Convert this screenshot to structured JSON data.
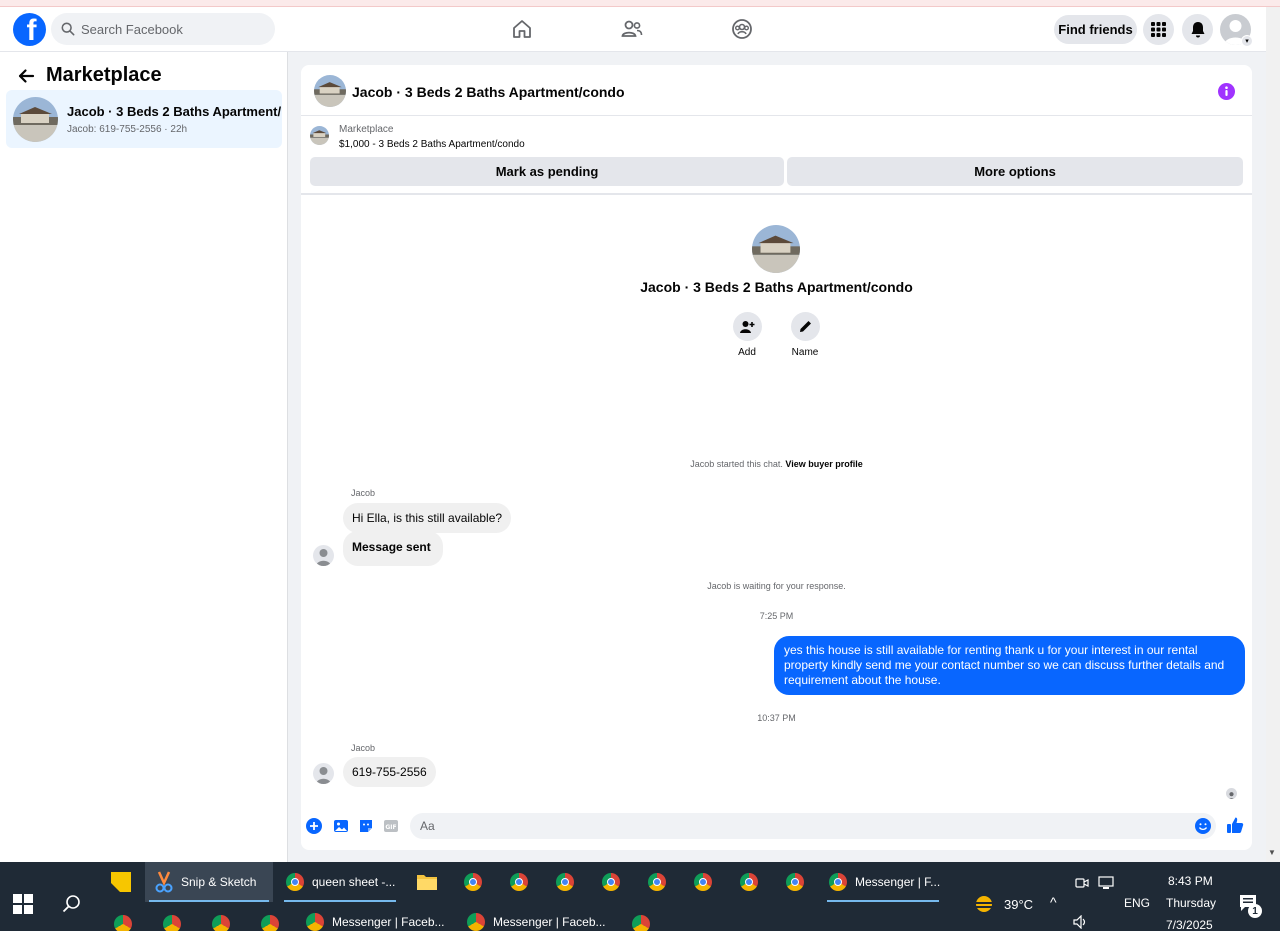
{
  "header": {
    "search_placeholder": "Search Facebook",
    "find_friends": "Find friends",
    "logo_letter": "f"
  },
  "sidebar": {
    "title": "Marketplace",
    "items": [
      {
        "title": "Jacob · 3 Beds 2 Baths Apartment/...",
        "subtitle": "Jacob: 619-755-2556 · 22h"
      }
    ]
  },
  "chat": {
    "title": "Jacob · 3 Beds 2 Baths Apartment/condo",
    "listing_category": "Marketplace",
    "listing_price": "$1,000 - 3 Beds 2 Baths Apartment/condo",
    "mark_pending": "Mark as pending",
    "more_options": "More options",
    "center_title": "Jacob · 3 Beds 2 Baths Apartment/condo",
    "action_add": "Add",
    "action_name": "Name",
    "started_text": "Jacob started this chat.",
    "view_buyer_profile": "View buyer profile",
    "messages": [
      {
        "sender": "Jacob",
        "text": "Hi Ella, is this still available?"
      },
      {
        "text": "Message sent"
      },
      {
        "system": "Jacob is waiting for your response."
      },
      {
        "time": "7:25 PM"
      },
      {
        "outgoing": "yes this house is still  available for renting thank u for your interest  in our rental property kindly send me your contact number so we can discuss further details and requirement about the house."
      },
      {
        "time": "10:37 PM"
      },
      {
        "sender": "Jacob",
        "text": "619-755-2556"
      }
    ],
    "composer_placeholder": "Aa"
  },
  "taskbar": {
    "apps": [
      {
        "label": "Snip & Sketch"
      },
      {
        "label": "queen sheet -..."
      },
      {
        "label": "Messenger | F..."
      },
      {
        "label": "Messenger | Faceb..."
      },
      {
        "label": "Messenger | Faceb..."
      }
    ],
    "weather": "39°C",
    "language": "ENG",
    "time": "8:43 PM",
    "day": "Thursday",
    "date": "7/3/2025",
    "notifications": "1"
  },
  "colors": {
    "brand": "#0866ff",
    "info": "#a033ff",
    "taskbar": "#1f2a36"
  }
}
